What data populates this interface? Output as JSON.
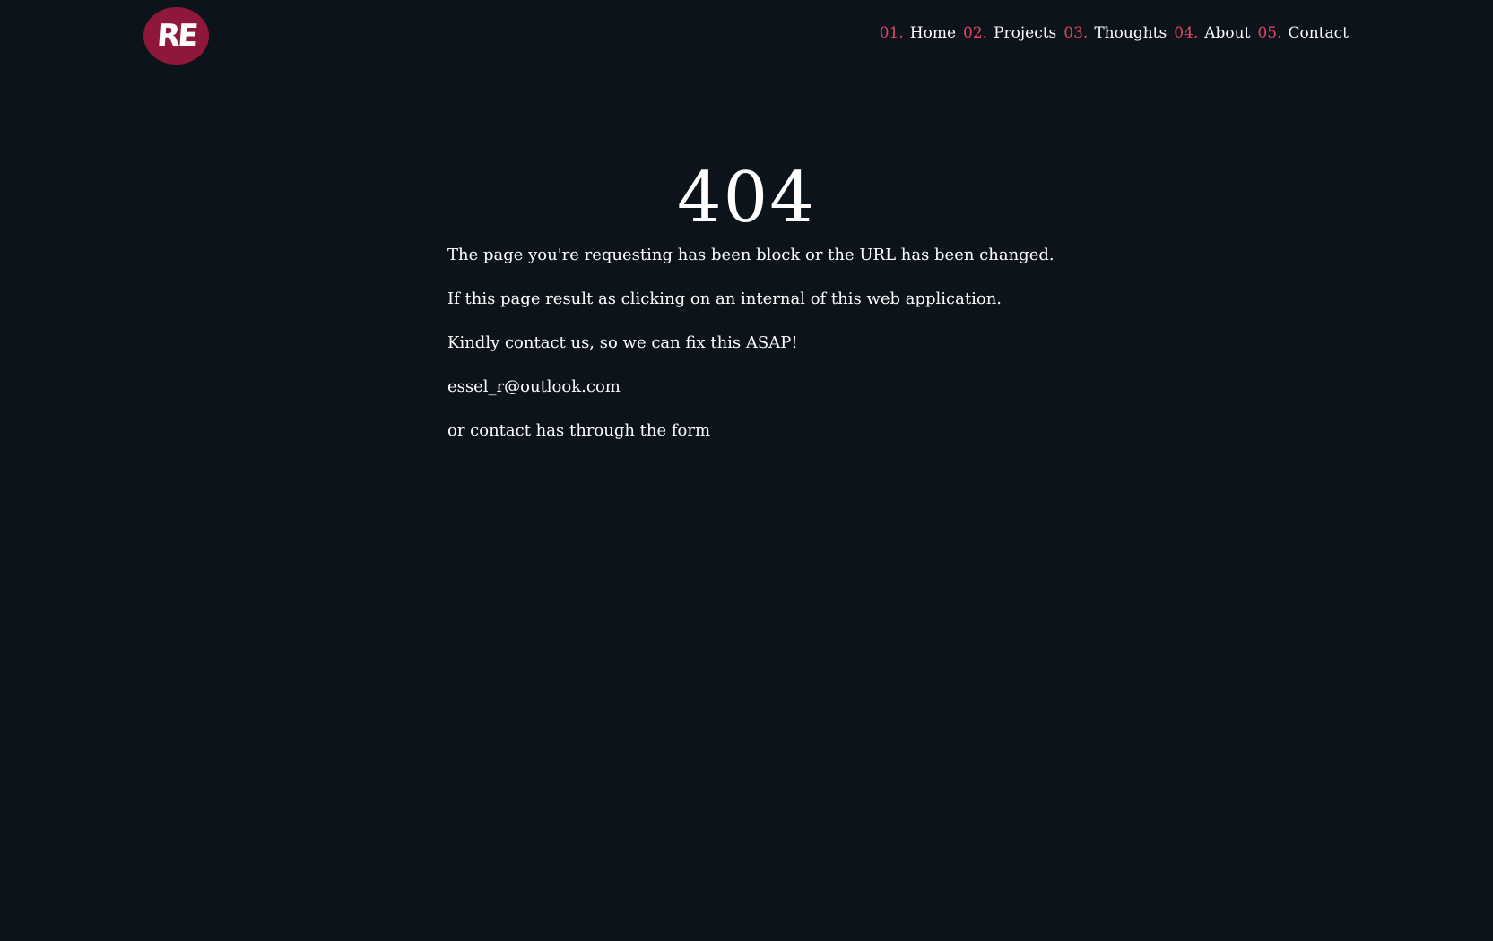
{
  "logo": {
    "text": "RE"
  },
  "nav": {
    "items": [
      {
        "number": "01.",
        "label": "Home"
      },
      {
        "number": "02.",
        "label": "Projects"
      },
      {
        "number": "03.",
        "label": "Thoughts"
      },
      {
        "number": "04.",
        "label": "About"
      },
      {
        "number": "05.",
        "label": "Contact"
      }
    ]
  },
  "error": {
    "code": "404",
    "lines": [
      "The page you're requesting has been block or the URL has been changed.",
      "If this page result as clicking on an internal of this web application.",
      "Kindly contact us, so we can fix this ASAP!",
      "essel_r@outlook.com",
      "or contact has through the form"
    ]
  },
  "colors": {
    "background": "#0d131b",
    "accent": "#e2445f",
    "logo_bg": "#8f1739",
    "text": "#ffffff"
  }
}
